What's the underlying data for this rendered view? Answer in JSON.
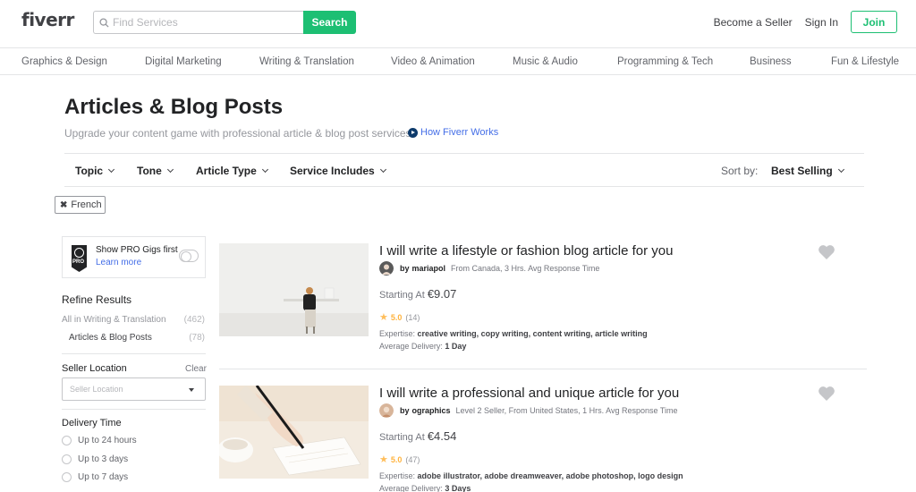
{
  "header": {
    "logo": "fiverr",
    "search_placeholder": "Find Services",
    "search_button": "Search",
    "become_seller": "Become a Seller",
    "sign_in": "Sign In",
    "join": "Join"
  },
  "categories": [
    "Graphics & Design",
    "Digital Marketing",
    "Writing & Translation",
    "Video & Animation",
    "Music & Audio",
    "Programming & Tech",
    "Business",
    "Fun & Lifestyle"
  ],
  "page": {
    "title": "Articles & Blog Posts",
    "subtitle": "Upgrade your content game with professional article & blog post services",
    "how_link": "How Fiverr Works"
  },
  "filters": [
    "Topic",
    "Tone",
    "Article Type",
    "Service Includes"
  ],
  "sort": {
    "label": "Sort by:",
    "value": "Best Selling"
  },
  "active_chip": "French",
  "sidebar": {
    "pro_title": "Show PRO Gigs first",
    "pro_link": "Learn more",
    "pro_badge_text": "PRO",
    "refine_title": "Refine Results",
    "refine_items": [
      {
        "label": "All in Writing & Translation",
        "count": "(462)"
      },
      {
        "label": "Articles & Blog Posts",
        "count": "(78)"
      }
    ],
    "seller_location_title": "Seller Location",
    "clear": "Clear",
    "seller_location_placeholder": "Seller Location",
    "delivery_title": "Delivery Time",
    "delivery_options": [
      "Up to 24 hours",
      "Up to 3 days",
      "Up to 7 days"
    ]
  },
  "gigs": [
    {
      "title": "I will write a lifestyle or fashion blog article for you",
      "seller_prefix": "by",
      "seller": "mariapol",
      "meta": "From Canada, 3 Hrs. Avg Response Time",
      "price_label": "Starting At",
      "price": "€9.07",
      "rating": "5.0",
      "reviews": "(14)",
      "expertise_label": "Expertise:",
      "expertise": "creative writing, copy writing, content writing, article writing",
      "delivery_label": "Average Delivery:",
      "delivery": "1 Day"
    },
    {
      "title": "I will write a professional and unique article for you",
      "seller_prefix": "by",
      "seller": "ographics",
      "meta": "Level 2 Seller, From United States, 1 Hrs. Avg Response Time",
      "price_label": "Starting At",
      "price": "€4.54",
      "rating": "5.0",
      "reviews": "(47)",
      "expertise_label": "Expertise:",
      "expertise": "adobe illustrator, adobe dreamweaver, adobe photoshop, logo design",
      "delivery_label": "Average Delivery:",
      "delivery": "3 Days"
    }
  ],
  "colors": {
    "brand_green": "#1dbf73",
    "link_blue": "#446ee7",
    "star": "#ffbe5b",
    "text_dark": "#222325"
  }
}
